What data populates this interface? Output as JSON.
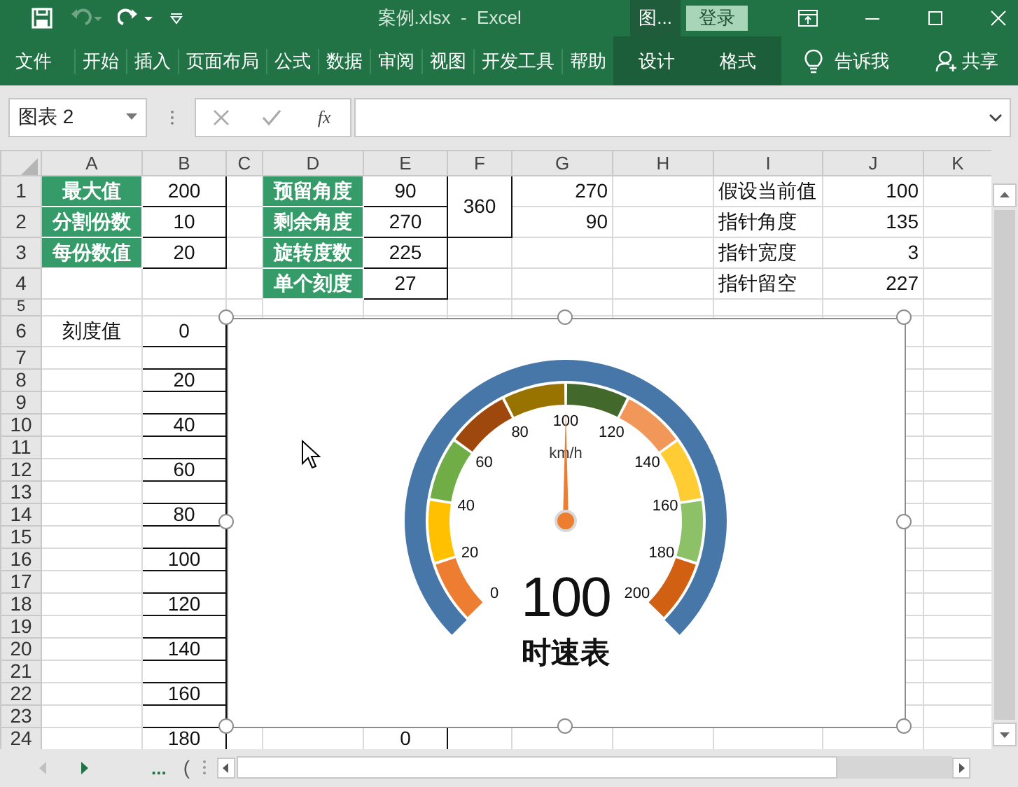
{
  "title_bar": {
    "quick_access": [
      {
        "kind": "save",
        "disabled": false
      },
      {
        "kind": "undo",
        "disabled": true
      },
      {
        "kind": "redo",
        "disabled": false
      },
      {
        "kind": "customize",
        "disabled": false
      }
    ],
    "title": "案例.xlsx  -  Excel",
    "context_label": "图...",
    "login": "登录"
  },
  "ribbon": {
    "tabs": [
      {
        "label": "文件",
        "contextual": false
      },
      {
        "label": "开始",
        "contextual": false
      },
      {
        "label": "插入",
        "contextual": false
      },
      {
        "label": "页面布局",
        "contextual": false
      },
      {
        "label": "公式",
        "contextual": false
      },
      {
        "label": "数据",
        "contextual": false
      },
      {
        "label": "审阅",
        "contextual": false
      },
      {
        "label": "视图",
        "contextual": false
      },
      {
        "label": "开发工具",
        "contextual": false
      },
      {
        "label": "帮助",
        "contextual": false
      },
      {
        "label": "设计",
        "contextual": true
      },
      {
        "label": "格式",
        "contextual": true
      }
    ],
    "tell_me": "告诉我",
    "share": "共享"
  },
  "formula_bar": {
    "name_box": "图表 2",
    "function_label": "fx"
  },
  "sheet": {
    "columns": [
      "A",
      "B",
      "C",
      "D",
      "E",
      "F",
      "G",
      "H",
      "I",
      "J",
      "K"
    ],
    "rows": [
      {
        "number": "1",
        "cells": [
          {
            "kind": "label",
            "text": "最大值"
          },
          {
            "kind": "boxed",
            "text": "200"
          },
          null,
          {
            "kind": "label",
            "text": "预留角度"
          },
          {
            "kind": "boxed",
            "text": "90"
          },
          {
            "kind": "merged",
            "text": "360",
            "rowspan": 2
          },
          {
            "kind": "right",
            "text": "270"
          },
          null,
          {
            "kind": "left",
            "text": "假设当前值"
          },
          {
            "kind": "right",
            "text": "100"
          },
          null
        ]
      },
      {
        "number": "2",
        "cells": [
          {
            "kind": "label",
            "text": "分割份数"
          },
          {
            "kind": "boxed",
            "text": "10"
          },
          null,
          {
            "kind": "label",
            "text": "剩余角度"
          },
          {
            "kind": "boxed",
            "text": "270"
          },
          {
            "kind": "right",
            "text": "90"
          },
          null,
          {
            "kind": "left",
            "text": "指针角度"
          },
          {
            "kind": "right",
            "text": "135"
          },
          null
        ]
      },
      {
        "number": "3",
        "cells": [
          {
            "kind": "label",
            "text": "每份数值"
          },
          {
            "kind": "boxed",
            "text": "20"
          },
          null,
          {
            "kind": "label",
            "text": "旋转度数"
          },
          {
            "kind": "boxed",
            "text": "225"
          },
          null,
          null,
          null,
          {
            "kind": "left",
            "text": "指针宽度"
          },
          {
            "kind": "right",
            "text": "3"
          },
          null
        ]
      },
      {
        "number": "4",
        "cells": [
          null,
          null,
          null,
          {
            "kind": "label",
            "text": "单个刻度"
          },
          {
            "kind": "boxed",
            "text": "27"
          },
          null,
          null,
          null,
          {
            "kind": "left",
            "text": "指针留空"
          },
          {
            "kind": "right",
            "text": "227"
          },
          null
        ]
      },
      {
        "number": "5",
        "cells": [
          null,
          null,
          null,
          null,
          null,
          null,
          null,
          null,
          null,
          null,
          null
        ]
      },
      {
        "number": "6",
        "cells": [
          {
            "kind": "center",
            "text": "刻度值"
          },
          {
            "kind": "boxed",
            "text": "0"
          },
          null,
          null,
          null,
          null,
          null,
          null,
          null,
          null,
          null
        ]
      },
      {
        "number": "7",
        "cells": [
          null,
          {
            "kind": "boxed"
          },
          null,
          null,
          null,
          null,
          null,
          null,
          null,
          null,
          null
        ]
      },
      {
        "number": "8",
        "cells": [
          null,
          {
            "kind": "boxed",
            "text": "20"
          },
          null,
          null,
          null,
          null,
          null,
          null,
          null,
          null,
          null
        ]
      },
      {
        "number": "9",
        "cells": [
          null,
          {
            "kind": "boxed"
          },
          null,
          null,
          null,
          null,
          null,
          null,
          null,
          null,
          null
        ]
      },
      {
        "number": "10",
        "cells": [
          null,
          {
            "kind": "boxed",
            "text": "40"
          },
          null,
          null,
          null,
          null,
          null,
          null,
          null,
          null,
          null
        ]
      },
      {
        "number": "11",
        "cells": [
          null,
          {
            "kind": "boxed"
          },
          null,
          null,
          null,
          null,
          null,
          null,
          null,
          null,
          null
        ]
      },
      {
        "number": "12",
        "cells": [
          null,
          {
            "kind": "boxed",
            "text": "60"
          },
          null,
          null,
          null,
          null,
          null,
          null,
          null,
          null,
          null
        ]
      },
      {
        "number": "13",
        "cells": [
          null,
          {
            "kind": "boxed"
          },
          null,
          null,
          null,
          null,
          null,
          null,
          null,
          null,
          null
        ]
      },
      {
        "number": "14",
        "cells": [
          null,
          {
            "kind": "boxed",
            "text": "80"
          },
          null,
          null,
          null,
          null,
          null,
          null,
          null,
          null,
          null
        ]
      },
      {
        "number": "15",
        "cells": [
          null,
          {
            "kind": "boxed"
          },
          null,
          null,
          null,
          null,
          null,
          null,
          null,
          null,
          null
        ]
      },
      {
        "number": "16",
        "cells": [
          null,
          {
            "kind": "boxed",
            "text": "100"
          },
          null,
          null,
          null,
          null,
          null,
          null,
          null,
          null,
          null
        ]
      },
      {
        "number": "17",
        "cells": [
          null,
          {
            "kind": "boxed"
          },
          null,
          null,
          null,
          null,
          null,
          null,
          null,
          null,
          null
        ]
      },
      {
        "number": "18",
        "cells": [
          null,
          {
            "kind": "boxed",
            "text": "120"
          },
          null,
          null,
          null,
          null,
          null,
          null,
          null,
          null,
          null
        ]
      },
      {
        "number": "19",
        "cells": [
          null,
          {
            "kind": "boxed"
          },
          null,
          null,
          null,
          null,
          null,
          null,
          null,
          null,
          null
        ]
      },
      {
        "number": "20",
        "cells": [
          null,
          {
            "kind": "boxed",
            "text": "140"
          },
          null,
          null,
          null,
          null,
          null,
          null,
          null,
          null,
          null
        ]
      },
      {
        "number": "21",
        "cells": [
          null,
          {
            "kind": "boxed"
          },
          null,
          null,
          null,
          null,
          null,
          null,
          null,
          null,
          null
        ]
      },
      {
        "number": "22",
        "cells": [
          null,
          {
            "kind": "boxed",
            "text": "160"
          },
          null,
          null,
          null,
          null,
          null,
          null,
          null,
          null,
          null
        ]
      },
      {
        "number": "23",
        "cells": [
          null,
          {
            "kind": "boxed"
          },
          null,
          null,
          null,
          null,
          null,
          null,
          null,
          null,
          null
        ]
      },
      {
        "number": "24",
        "cells": [
          null,
          {
            "kind": "boxed",
            "text": "180"
          },
          null,
          null,
          {
            "kind": "boxed",
            "text": "0"
          },
          null,
          null,
          null,
          null,
          null,
          null
        ]
      }
    ]
  },
  "gauge": {
    "segments": [
      {
        "color": "#ed7d31"
      },
      {
        "color": "#ffc000"
      },
      {
        "color": "#70ad47"
      },
      {
        "color": "#9e480e"
      },
      {
        "color": "#997300"
      },
      {
        "color": "#43682b"
      },
      {
        "color": "#f1975a"
      },
      {
        "color": "#ffcd33"
      },
      {
        "color": "#8cc168"
      },
      {
        "color": "#d26012"
      }
    ],
    "scale_labels": [
      "0",
      "20",
      "40",
      "60",
      "80",
      "100",
      "120",
      "140",
      "160",
      "180",
      "200"
    ],
    "unit": "km/h",
    "level": 0.5,
    "value_label": "100",
    "title": "时速表"
  },
  "bottom_bar": {
    "more_label": "...",
    "partial_tab": "("
  }
}
